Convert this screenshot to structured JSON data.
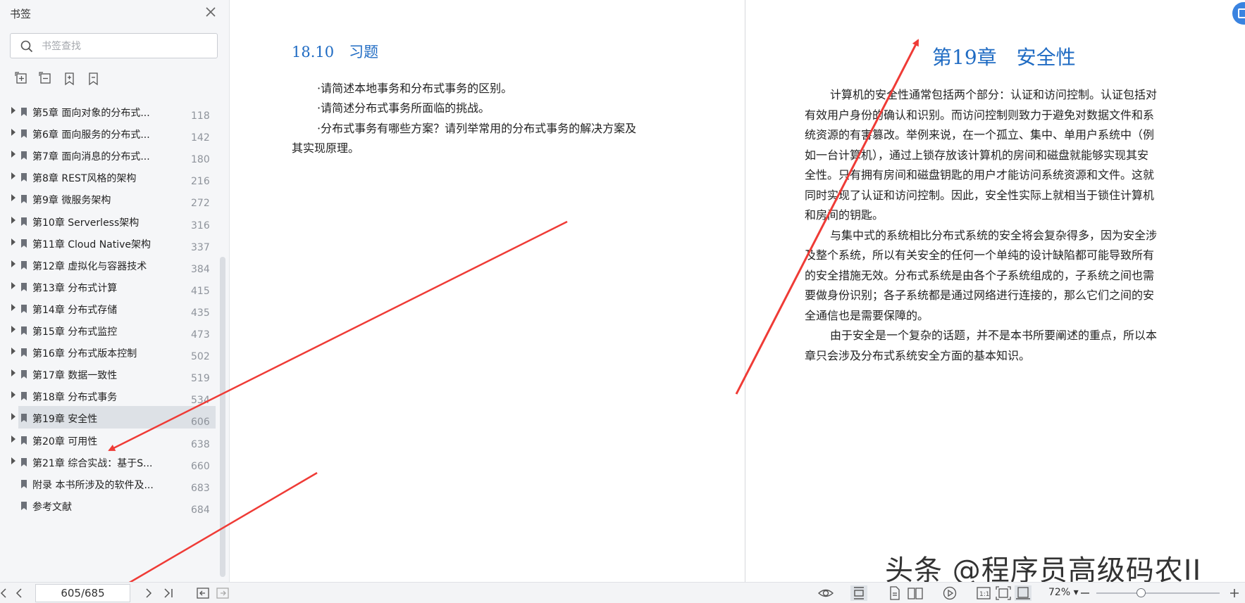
{
  "sidebar": {
    "title": "书签",
    "search_placeholder": "书签查找",
    "bookmarks": [
      {
        "label": "第5章 面向对象的分布式...",
        "page": "118",
        "expandable": true
      },
      {
        "label": "第6章 面向服务的分布式...",
        "page": "142",
        "expandable": true
      },
      {
        "label": "第7章 面向消息的分布式...",
        "page": "180",
        "expandable": true
      },
      {
        "label": "第8章 REST风格的架构",
        "page": "216",
        "expandable": true
      },
      {
        "label": "第9章 微服务架构",
        "page": "272",
        "expandable": true
      },
      {
        "label": "第10章 Serverless架构",
        "page": "316",
        "expandable": true
      },
      {
        "label": "第11章 Cloud Native架构",
        "page": "337",
        "expandable": true
      },
      {
        "label": "第12章 虚拟化与容器技术",
        "page": "384",
        "expandable": true
      },
      {
        "label": "第13章 分布式计算",
        "page": "415",
        "expandable": true
      },
      {
        "label": "第14章 分布式存储",
        "page": "435",
        "expandable": true
      },
      {
        "label": "第15章 分布式监控",
        "page": "473",
        "expandable": true
      },
      {
        "label": "第16章 分布式版本控制",
        "page": "502",
        "expandable": true
      },
      {
        "label": "第17章 数据一致性",
        "page": "519",
        "expandable": true
      },
      {
        "label": "第18章 分布式事务",
        "page": "534",
        "expandable": true
      },
      {
        "label": "第19章 安全性",
        "page": "606",
        "expandable": true,
        "selected": true
      },
      {
        "label": "第20章 可用性",
        "page": "638",
        "expandable": true
      },
      {
        "label": "第21章 综合实战：基于S...",
        "page": "660",
        "expandable": true
      },
      {
        "label": "附录 本书所涉及的软件及...",
        "page": "683",
        "expandable": false
      },
      {
        "label": "参考文献",
        "page": "684",
        "expandable": false
      }
    ]
  },
  "left_page": {
    "heading": "18.10　习题",
    "lines": [
      "·请简述本地事务和分布式事务的区别。",
      "·请简述分布式事务所面临的挑战。",
      "·分布式事务有哪些方案？请列举常用的分布式事务的解决方案及",
      "其实现原理。"
    ]
  },
  "right_page": {
    "heading": "第19章　安全性",
    "lines": [
      "计算机的安全性通常包括两个部分：认证和访问控制。认证包括对",
      "有效用户身份的确认和识别。而访问控制则致力于避免对数据文件和系",
      "统资源的有害篡改。举例来说，在一个孤立、集中、单用户系统中（例",
      "如一台计算机），通过上锁存放该计算机的房间和磁盘就能够实现其安",
      "全性。只有拥有房间和磁盘钥匙的用户才能访问系统资源和文件。这就",
      "同时实现了认证和访问控制。因此，安全性实际上就相当于锁住计算机",
      "和房间的钥匙。",
      "与集中式的系统相比分布式系统的安全将会复杂得多，因为安全涉",
      "及整个系统，所以有关安全的任何一个单纯的设计缺陷都可能导致所有",
      "的安全措施无效。分布式系统是由各个子系统组成的，子系统之间也需",
      "要做身份识别；各子系统都是通过网络进行连接的，那么它们之间的安",
      "全通信也是需要保障的。",
      "由于安全是一个复杂的话题，并不是本书所要阐述的重点，所以本",
      "章只会涉及分布式系统安全方面的基本知识。"
    ]
  },
  "watermark": "头条 @程序员高级码农II",
  "toolbar": {
    "page_indicator": "605/685",
    "zoom": "72%",
    "zoom_level_percent": 72
  },
  "colors": {
    "heading_blue": "#1f6bc3",
    "annotation_red": "#ef3b36",
    "selection_gray": "#dde1e6"
  }
}
